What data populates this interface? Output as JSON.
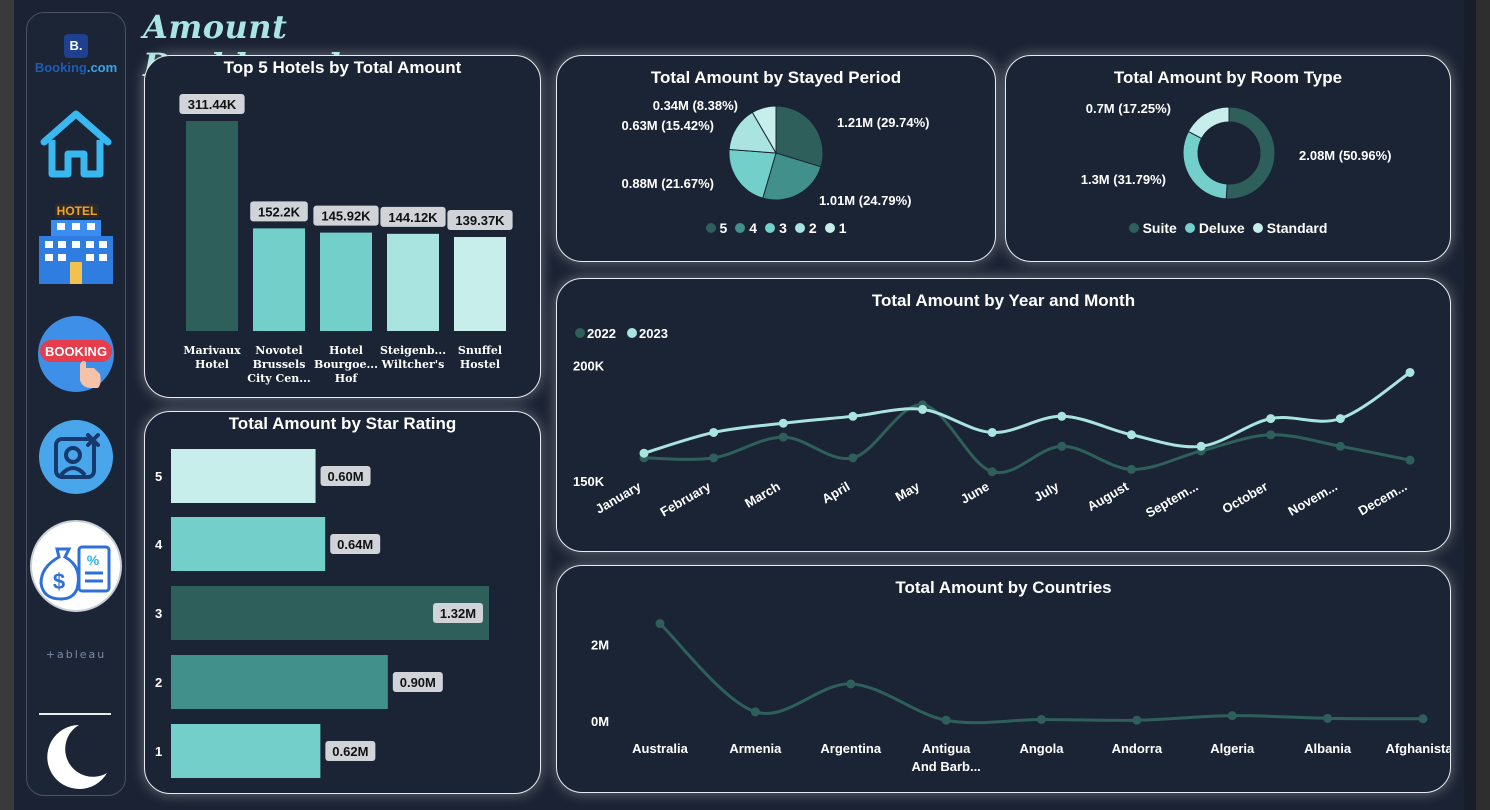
{
  "page": {
    "title": "Amount Dashboard"
  },
  "colors": {
    "c1": "#2e5f5b",
    "c2": "#42908c",
    "c3": "#72cfca",
    "c4": "#a9e4e1",
    "c5": "#c8eeec",
    "bg": "#1a2233"
  },
  "sidebar": {
    "brand_letter": "B.",
    "brand_name_a": "Booking",
    "brand_name_b": ".com",
    "hotel_sign": "HOTEL",
    "booking_badge": "BOOKING",
    "tableau_label": "+ableau",
    "items": [
      {
        "icon": "booking-logo-icon"
      },
      {
        "icon": "home-icon"
      },
      {
        "icon": "hotel-icon"
      },
      {
        "icon": "booking-badge-icon"
      },
      {
        "icon": "user-remove-icon"
      },
      {
        "icon": "money-bag-icon"
      },
      {
        "icon": "tableau-logo-icon"
      },
      {
        "icon": "moon-icon"
      }
    ]
  },
  "chart_data": [
    {
      "id": "top_hotels",
      "type": "bar",
      "title": "Top 5 Hotels by Total Amount",
      "categories": [
        [
          "Marivaux",
          "Hotel"
        ],
        [
          "Novotel",
          "Brussels",
          "City Cen..."
        ],
        [
          "Hotel",
          "Bourgoe...",
          "Hof"
        ],
        [
          "Steigenb...",
          "Wiltcher's"
        ],
        [
          "Snuffel",
          "Hostel"
        ]
      ],
      "values": [
        311.44,
        152.2,
        145.92,
        144.12,
        139.37
      ],
      "labels": [
        "311.44K",
        "152.2K",
        "145.92K",
        "144.12K",
        "139.37K"
      ],
      "unit": "K",
      "colors": [
        "#2e5f5b",
        "#72cfca",
        "#72cfca",
        "#a9e4e1",
        "#c8eeec"
      ]
    },
    {
      "id": "star_rating",
      "type": "bar",
      "orientation": "horizontal",
      "title": "Total Amount by Star Rating",
      "categories": [
        "5",
        "4",
        "3",
        "2",
        "1"
      ],
      "values": [
        0.6,
        0.64,
        1.32,
        0.9,
        0.62
      ],
      "labels": [
        "0.60M",
        "0.64M",
        "1.32M",
        "0.90M",
        "0.62M"
      ],
      "unit": "M",
      "colors": [
        "#c8eeec",
        "#72cfca",
        "#2e5f5b",
        "#42908c",
        "#72cfca"
      ]
    },
    {
      "id": "stayed_period",
      "type": "pie",
      "title": "Total Amount by Stayed Period",
      "slices": [
        {
          "name": "5",
          "value": 1.21,
          "label": "1.21M (29.74%)",
          "percent": 29.74,
          "color": "#2e5f5b"
        },
        {
          "name": "4",
          "value": 1.01,
          "label": "1.01M (24.79%)",
          "percent": 24.79,
          "color": "#42908c"
        },
        {
          "name": "3",
          "value": 0.88,
          "label": "0.88M (21.67%)",
          "percent": 21.67,
          "color": "#72cfca"
        },
        {
          "name": "2",
          "value": 0.63,
          "label": "0.63M (15.42%)",
          "percent": 15.42,
          "color": "#a9e4e1"
        },
        {
          "name": "1",
          "value": 0.34,
          "label": "0.34M (8.38%)",
          "percent": 8.38,
          "color": "#c8eeec"
        }
      ]
    },
    {
      "id": "room_type",
      "type": "pie",
      "donut": true,
      "title": "Total Amount by Room Type",
      "slices": [
        {
          "name": "Suite",
          "value": 2.08,
          "label": "2.08M (50.96%)",
          "percent": 50.96,
          "color": "#2e5f5b"
        },
        {
          "name": "Deluxe",
          "value": 1.3,
          "label": "1.3M (31.79%)",
          "percent": 31.79,
          "color": "#72cfca"
        },
        {
          "name": "Standard",
          "value": 0.7,
          "label": "0.7M (17.25%)",
          "percent": 17.25,
          "color": "#c8eeec"
        }
      ]
    },
    {
      "id": "year_month",
      "type": "line",
      "title": "Total Amount by Year and Month",
      "categories": [
        "January",
        "February",
        "March",
        "April",
        "May",
        "June",
        "July",
        "August",
        "Septem...",
        "October",
        "Novem...",
        "Decem..."
      ],
      "series": [
        {
          "name": "2022",
          "color": "#2e5f5b",
          "values": [
            160,
            160,
            169,
            160,
            183,
            154,
            165,
            155,
            163,
            170,
            165,
            159
          ]
        },
        {
          "name": "2023",
          "color": "#a9e4e1",
          "values": [
            162,
            171,
            175,
            178,
            181,
            171,
            178,
            170,
            165,
            177,
            177,
            197
          ]
        }
      ],
      "ytick_labels": [
        "200K",
        "150K"
      ],
      "yticks": [
        200,
        150
      ],
      "ylim": [
        140,
        205
      ],
      "legend_position": "top-left"
    },
    {
      "id": "countries",
      "type": "line",
      "title": "Total Amount by Countries",
      "categories": [
        [
          "Australia"
        ],
        [
          "Armenia"
        ],
        [
          "Argentina"
        ],
        [
          "Antigua",
          "And Barb..."
        ],
        [
          "Angola"
        ],
        [
          "Andorra"
        ],
        [
          "Algeria"
        ],
        [
          "Albania"
        ],
        [
          "Afghanistan"
        ]
      ],
      "series": [
        {
          "name": "",
          "color": "#2e5f5b",
          "values": [
            2.55,
            0.24,
            0.97,
            0.02,
            0.04,
            0.02,
            0.14,
            0.07,
            0.06
          ]
        }
      ],
      "ytick_labels": [
        "2M",
        "0M"
      ],
      "yticks": [
        2,
        0
      ],
      "ylim": [
        0,
        2.8
      ]
    }
  ]
}
